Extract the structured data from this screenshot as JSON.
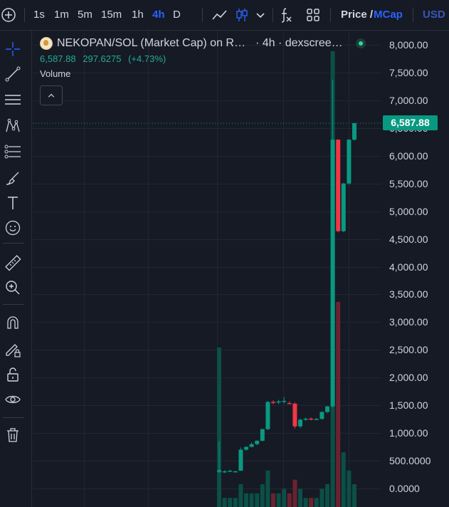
{
  "toolbar": {
    "add_symbol_icon": "plus-circle-icon",
    "intervals": [
      "1s",
      "1m",
      "5m",
      "15m",
      "1h",
      "4h",
      "D"
    ],
    "active_interval": "4h",
    "chart_style_icon": "line-chart-icon",
    "candles_icon": "candles-icon",
    "indicators_icon": "fx-icon",
    "layout_icon": "grid-icon",
    "price_label": "Price /",
    "mcap_label": "MCap",
    "currency_label": "USD"
  },
  "legend": {
    "symbol": "NEKOPAN/SOL (Market Cap) on R…",
    "interval_source": "· 4h · dexscree…",
    "last": "6,587.88",
    "change": "297.6275",
    "change_pct": "(+4.73%)",
    "volume_label": "Volume"
  },
  "tools": [
    "crosshair-icon",
    "trend-line-icon",
    "horizontal-lines-icon",
    "pattern-icon",
    "fib-icon",
    "brush-icon",
    "text-icon",
    "emoji-icon",
    "ruler-icon",
    "zoom-in-icon",
    "magnet-icon",
    "lock-pencil-icon",
    "lock-icon",
    "eye-icon",
    "trash-icon"
  ],
  "axis": {
    "labels": [
      "8,000.00",
      "7,500.00",
      "7,000.00",
      "6,500.00",
      "6,000.00",
      "5,500.00",
      "5,000.00",
      "4,500.00",
      "4,000.00",
      "3,500.00",
      "3,000.00",
      "2,500.00",
      "2,000.00",
      "1,500.00",
      "1,000.00",
      "500.0000",
      "0.0000"
    ],
    "values": [
      8000,
      7500,
      7000,
      6500,
      6000,
      5500,
      5000,
      4500,
      4000,
      3500,
      3000,
      2500,
      2000,
      1500,
      1000,
      500,
      0
    ],
    "current_price_label": "6,587.88",
    "current_price": 6587.88
  },
  "colors": {
    "up": "#089981",
    "down": "#f23645",
    "background": "#161a25",
    "accent": "#2962ff"
  },
  "chart_data": {
    "type": "candlestick",
    "y_min": 0,
    "y_max": 8000,
    "candles": [
      {
        "o": 300,
        "h": 850,
        "l": 280,
        "c": 330
      },
      {
        "o": 300,
        "h": 330,
        "l": 280,
        "c": 310
      },
      {
        "o": 320,
        "h": 340,
        "l": 300,
        "c": 320
      },
      {
        "o": 310,
        "h": 320,
        "l": 300,
        "c": 310
      },
      {
        "o": 320,
        "h": 740,
        "l": 320,
        "c": 700
      },
      {
        "o": 700,
        "h": 760,
        "l": 680,
        "c": 750
      },
      {
        "o": 750,
        "h": 830,
        "l": 740,
        "c": 800
      },
      {
        "o": 800,
        "h": 870,
        "l": 780,
        "c": 860
      },
      {
        "o": 860,
        "h": 1080,
        "l": 850,
        "c": 1070
      },
      {
        "o": 1070,
        "h": 1580,
        "l": 1050,
        "c": 1560
      },
      {
        "o": 1560,
        "h": 1590,
        "l": 1520,
        "c": 1550
      },
      {
        "o": 1550,
        "h": 1600,
        "l": 1520,
        "c": 1570
      },
      {
        "o": 1570,
        "h": 1650,
        "l": 1530,
        "c": 1580
      },
      {
        "o": 1540,
        "h": 1570,
        "l": 1530,
        "c": 1530
      },
      {
        "o": 1530,
        "h": 1550,
        "l": 1080,
        "c": 1120
      },
      {
        "o": 1120,
        "h": 1260,
        "l": 1090,
        "c": 1240
      },
      {
        "o": 1240,
        "h": 1280,
        "l": 1220,
        "c": 1260
      },
      {
        "o": 1260,
        "h": 1280,
        "l": 1230,
        "c": 1250
      },
      {
        "o": 1250,
        "h": 1270,
        "l": 1230,
        "c": 1255
      },
      {
        "o": 1255,
        "h": 1390,
        "l": 1240,
        "c": 1380
      },
      {
        "o": 1380,
        "h": 1490,
        "l": 1360,
        "c": 1480
      },
      {
        "o": 1480,
        "h": 7370,
        "l": 1460,
        "c": 6290
      },
      {
        "o": 6290,
        "h": 6300,
        "l": 4620,
        "c": 4640
      },
      {
        "o": 4640,
        "h": 5510,
        "l": 4620,
        "c": 5500
      },
      {
        "o": 5500,
        "h": 6300,
        "l": 5480,
        "c": 6290
      },
      {
        "o": 6290,
        "h": 6587.88,
        "l": 6270,
        "c": 6587.88
      }
    ],
    "volume": [
      0.35,
      0.02,
      0.02,
      0.02,
      0.05,
      0.03,
      0.03,
      0.03,
      0.05,
      0.08,
      0.03,
      0.03,
      0.04,
      0.03,
      0.06,
      0.04,
      0.02,
      0.02,
      0.02,
      0.04,
      0.05,
      1.0,
      0.45,
      0.12,
      0.08,
      0.05
    ]
  }
}
